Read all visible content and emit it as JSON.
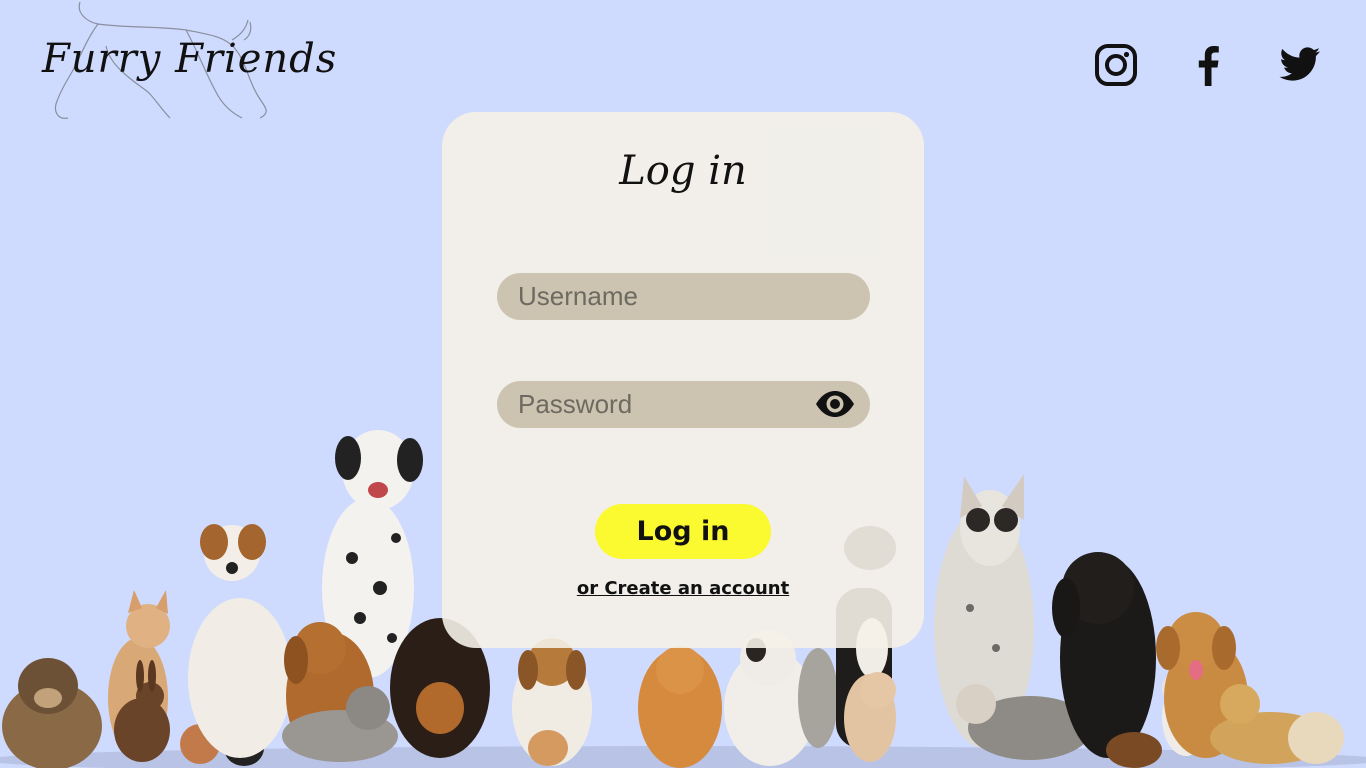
{
  "brand": {
    "name": "Furry Friends",
    "logo_icon": "cat-outline-icon"
  },
  "social": {
    "instagram_icon": "instagram-icon",
    "facebook_icon": "facebook-icon",
    "twitter_icon": "twitter-icon"
  },
  "login_form": {
    "title": "Log in",
    "username_placeholder": "Username",
    "username_value": "",
    "password_placeholder": "Password",
    "password_value": "",
    "show_password_icon": "eye-icon",
    "submit_label": "Log in",
    "create_account_label": "or Create an account"
  },
  "colors": {
    "background": "#cfdbfe",
    "card": "#f5f1e8",
    "field": "#ccc4b1",
    "button": "#fbf92f"
  },
  "background_image": "group-of-pets-photo"
}
